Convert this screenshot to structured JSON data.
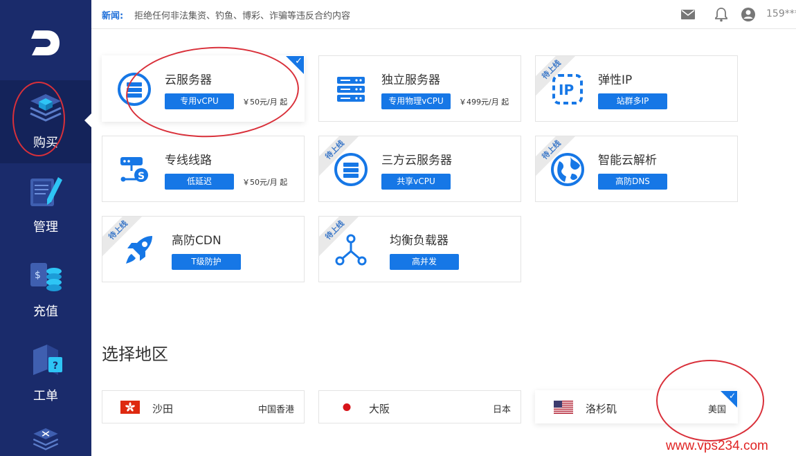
{
  "sidebar": {
    "items": [
      {
        "label": "购买",
        "icon": "cube-stack-icon",
        "active": true
      },
      {
        "label": "管理",
        "icon": "notebook-pen-icon",
        "active": false
      },
      {
        "label": "充值",
        "icon": "coins-icon",
        "active": false
      },
      {
        "label": "工单",
        "icon": "ticket-question-icon",
        "active": false
      }
    ]
  },
  "topbar": {
    "news_label": "新闻:",
    "news_text": "拒绝任何非法集资、钓鱼、博彩、诈骗等违反合约内容",
    "user": "159***"
  },
  "products": [
    {
      "title": "云服务器",
      "tag": "专用vCPU",
      "price": "￥50元/月 起",
      "icon": "server-circle-icon",
      "selected": true
    },
    {
      "title": "独立服务器",
      "tag": "专用物理vCPU",
      "price": "￥499元/月 起",
      "icon": "server-rack-icon"
    },
    {
      "title": "弹性IP",
      "tag": "站群多IP",
      "icon": "ip-icon",
      "ribbon": "待上线"
    },
    {
      "title": "专线线路",
      "tag": "低延迟",
      "price": "￥50元/月 起",
      "icon": "dedicated-line-icon"
    },
    {
      "title": "三方云服务器",
      "tag": "共享vCPU",
      "icon": "server-circle-icon",
      "ribbon": "待上线"
    },
    {
      "title": "智能云解析",
      "tag": "高防DNS",
      "icon": "globe-icon",
      "ribbon": "待上线"
    },
    {
      "title": "高防CDN",
      "tag": "T级防护",
      "icon": "rocket-icon",
      "ribbon": "待上线"
    },
    {
      "title": "均衡负载器",
      "tag": "高并发",
      "icon": "load-balancer-icon",
      "ribbon": "待上线"
    }
  ],
  "region_section_title": "选择地区",
  "regions": [
    {
      "city": "沙田",
      "country": "中国香港",
      "flag": "hong-kong-flag-icon"
    },
    {
      "city": "大阪",
      "country": "日本",
      "flag": "japan-flag-icon"
    },
    {
      "city": "洛杉矶",
      "country": "美国",
      "flag": "usa-flag-icon",
      "selected": true
    }
  ],
  "watermark": "www.vps234.com",
  "colors": {
    "sidebar": "#1a2b6b",
    "accent": "#1677e6",
    "annotation": "#d9303a"
  }
}
